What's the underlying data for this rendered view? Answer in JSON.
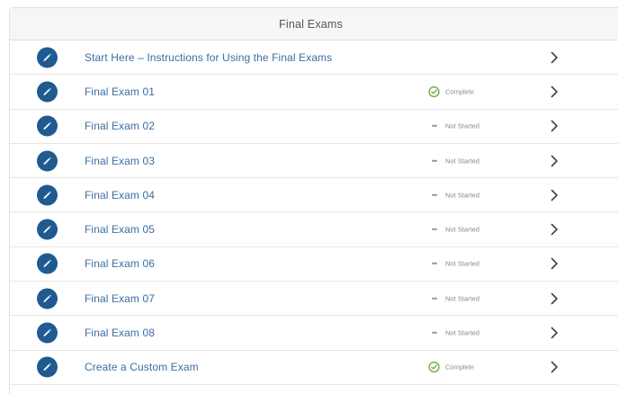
{
  "header": {
    "title": "Final Exams"
  },
  "colors": {
    "accent": "#1f5a91",
    "link": "#3b6ea3",
    "complete": "#7bb04a",
    "muted": "#8a8a8a"
  },
  "rows": [
    {
      "label": "Start Here – Instructions for Using the Final Exams",
      "status": "",
      "icon": "pencil-icon"
    },
    {
      "label": "Final Exam 01",
      "status": "Complete",
      "icon": "pencil-icon"
    },
    {
      "label": "Final Exam 02",
      "status": "Not Started",
      "icon": "pencil-icon"
    },
    {
      "label": "Final Exam 03",
      "status": "Not Started",
      "icon": "pencil-icon"
    },
    {
      "label": "Final Exam 04",
      "status": "Not Started",
      "icon": "pencil-icon"
    },
    {
      "label": "Final Exam 05",
      "status": "Not Started",
      "icon": "pencil-icon"
    },
    {
      "label": "Final Exam 06",
      "status": "Not Started",
      "icon": "pencil-icon"
    },
    {
      "label": "Final Exam 07",
      "status": "Not Started",
      "icon": "pencil-icon"
    },
    {
      "label": "Final Exam 08",
      "status": "Not Started",
      "icon": "pencil-icon"
    },
    {
      "label": "Create a Custom Exam",
      "status": "Complete",
      "icon": "pencil-icon"
    }
  ]
}
